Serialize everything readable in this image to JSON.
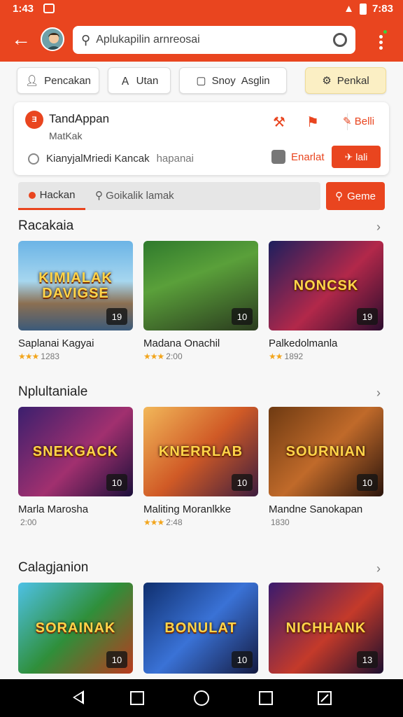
{
  "status": {
    "time_left": "1:43",
    "time_right": "7:83"
  },
  "appbar": {
    "search_text": "Aplukapilin arnreosai"
  },
  "chips": [
    {
      "label": "Pencakan",
      "icon": "person-icon"
    },
    {
      "label": "Utan",
      "icon": "text-icon"
    },
    {
      "label": "Snoy",
      "extra": "Asglin",
      "icon": "box-icon"
    },
    {
      "label": "Penkal",
      "icon": "gear-icon"
    }
  ],
  "card": {
    "logo": "Ǝ",
    "title": "TandAppan",
    "subtitle": "MatKak",
    "action_label": "Belli",
    "row2_main": "KianyjalMriedi Kancak",
    "row2_muted": "hapanai",
    "enarlat_label": "Enarlat",
    "button_label": "lali"
  },
  "filter": {
    "tab_label": "Hackan",
    "placeholder": "Goikalik lamak",
    "button_label": "Geme"
  },
  "sections": [
    {
      "title": "Racakaia",
      "items": [
        {
          "name": "Saplanai Kagyai",
          "rating": "1283",
          "stars": "★★★",
          "badge": "19",
          "art": "KIMIALAK DAVIGSE"
        },
        {
          "name": "Madana Onachil",
          "rating": "2:00",
          "stars": "★★★",
          "badge": "10",
          "art": ""
        },
        {
          "name": "Palkedolmanla",
          "rating": "1892",
          "stars": "★★",
          "badge": "19",
          "art": "NONCSK"
        }
      ]
    },
    {
      "title": "Nplultaniale",
      "items": [
        {
          "name": "Marla Marosha",
          "rating": "2:00",
          "stars": "",
          "badge": "10",
          "art": "SNEKGACK"
        },
        {
          "name": "Maliting Moranlkke",
          "rating": "2:48",
          "stars": "★★★",
          "badge": "10",
          "art": "KNERRLAB"
        },
        {
          "name": "Mandne Sanokapan",
          "rating": "1830",
          "stars": "",
          "badge": "10",
          "art": "SOURNIAN"
        }
      ]
    },
    {
      "title": "Calagjanion",
      "items": [
        {
          "name": "",
          "rating": "",
          "stars": "",
          "badge": "10",
          "art": "SORAINAK"
        },
        {
          "name": "",
          "rating": "",
          "stars": "",
          "badge": "10",
          "art": "BONULAT"
        },
        {
          "name": "",
          "rating": "",
          "stars": "",
          "badge": "13",
          "art": "NICHHANK"
        }
      ]
    }
  ],
  "nav": [
    "back-icon",
    "recents-icon",
    "home-icon",
    "overview-icon",
    "edit-icon"
  ]
}
